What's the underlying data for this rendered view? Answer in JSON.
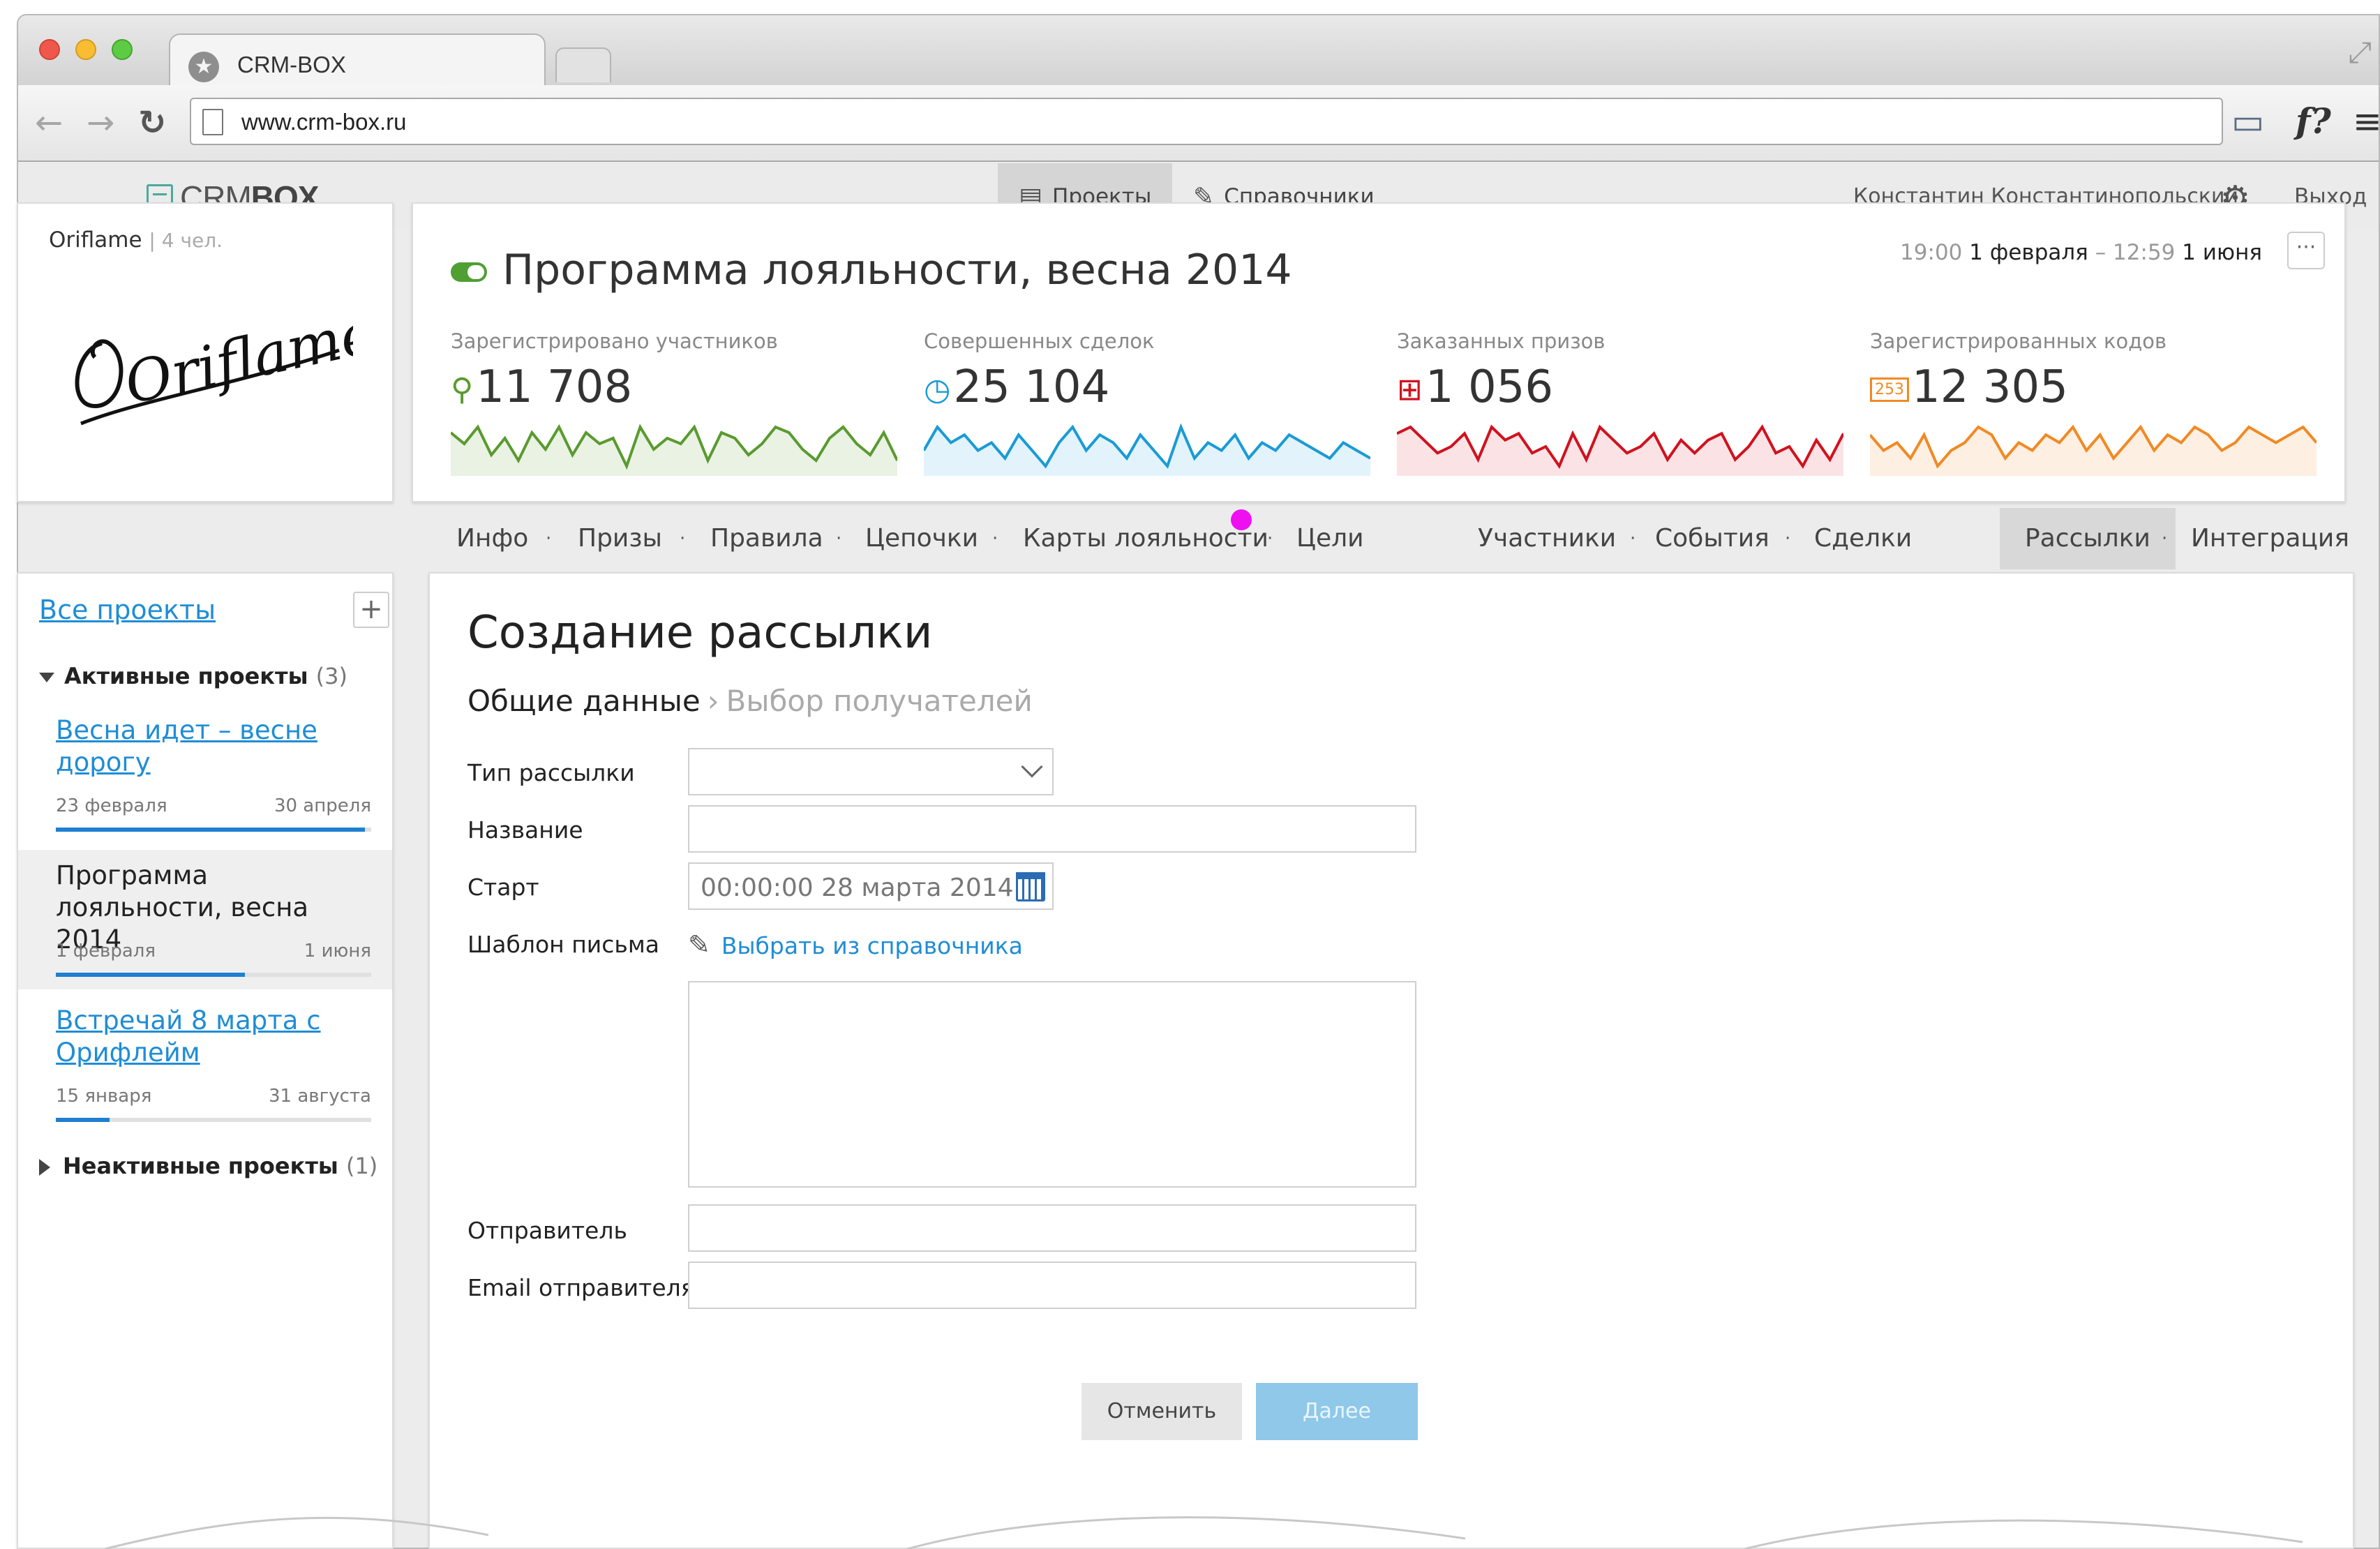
{
  "browser": {
    "tab_title": "CRM-BOX",
    "url": "www.crm-box.ru"
  },
  "app": {
    "logo_light": "CRM",
    "logo_bold": "BOX",
    "nav": {
      "projects": "Проекты",
      "references": "Справочники"
    },
    "user_name": "Константин Константинопольский",
    "logout": "Выход"
  },
  "project_card": {
    "name": "Oriflame",
    "members": "4 чел.",
    "logo_text": "Oriflame"
  },
  "campaign": {
    "title": "Программа лояльности, весна 2014",
    "start_time": "19:00",
    "start_date": "1 февраля",
    "dash": "–",
    "end_time": "12:59",
    "end_date": "1 июня",
    "more": "···",
    "stats": [
      {
        "label": "Зарегистрировано участников",
        "value": "11 708",
        "icon": "user-icon",
        "color": "#5a9a2f",
        "fill": "#e9f2e3",
        "spark": [
          8,
          6,
          9,
          4,
          7,
          3,
          8,
          5,
          9,
          4,
          8,
          6,
          7,
          2,
          9,
          5,
          7,
          6,
          9,
          3,
          8,
          7,
          4,
          6,
          9,
          8,
          5,
          3,
          7,
          9,
          6,
          4,
          8,
          3
        ]
      },
      {
        "label": "Совершенных сделок",
        "value": "25 104",
        "icon": "clock-icon",
        "color": "#1a9bd6",
        "fill": "#e2f3fb",
        "spark": [
          5,
          8,
          6,
          7,
          5,
          6,
          4,
          7,
          5,
          3,
          6,
          8,
          5,
          7,
          6,
          4,
          7,
          5,
          3,
          8,
          4,
          6,
          5,
          7,
          4,
          6,
          5,
          7,
          6,
          5,
          4,
          6,
          5,
          4
        ]
      },
      {
        "label": "Заказанных призов",
        "value": "1 056",
        "icon": "gift-icon",
        "color": "#d0121f",
        "fill": "#fbe3e5",
        "spark": [
          7,
          8,
          6,
          4,
          5,
          7,
          3,
          8,
          6,
          7,
          4,
          5,
          2,
          7,
          3,
          8,
          6,
          4,
          5,
          7,
          3,
          6,
          4,
          6,
          7,
          3,
          5,
          8,
          4,
          5,
          2,
          6,
          3,
          7
        ]
      },
      {
        "label": "Зарегистрированных кодов",
        "value": "12 305",
        "icon": "code-badge-icon",
        "color": "#f08a24",
        "fill": "#fdefe2",
        "spark": [
          5,
          3,
          4,
          2,
          5,
          1,
          3,
          4,
          6,
          5,
          2,
          4,
          3,
          5,
          4,
          6,
          3,
          5,
          2,
          4,
          6,
          3,
          5,
          4,
          6,
          5,
          3,
          4,
          6,
          5,
          4,
          5,
          6,
          4
        ]
      }
    ],
    "code_badge": "253"
  },
  "subnav": {
    "items": [
      "Инфо",
      "Призы",
      "Правила",
      "Цепочки",
      "Карты лояльности",
      "Цели",
      "Участники",
      "События",
      "Сделки",
      "Рассылки",
      "Интеграция"
    ],
    "dot": "·",
    "active": "Рассылки"
  },
  "sidebar": {
    "all_projects": "Все проекты",
    "add": "+",
    "active_group": "Активные  проекты",
    "active_count": "(3)",
    "inactive_group": "Неактивные проекты",
    "inactive_count": "(1)",
    "projects": [
      {
        "title": "Весна идет – весне дорогу",
        "start": "23 февраля",
        "end": "30 апреля",
        "progress": 0.98,
        "current": false
      },
      {
        "title": "Программа лояльности, весна 2014",
        "start": "1 февраля",
        "end": "1 июня",
        "progress": 0.6,
        "current": true
      },
      {
        "title": "Встречай 8 марта с Орифлейм",
        "start": "15 января",
        "end": "31 августа",
        "progress": 0.17,
        "current": false
      }
    ]
  },
  "form": {
    "title": "Создание рассылки",
    "step_current": "Общие данные",
    "step_sep": "›",
    "step_next": "Выбор получателей",
    "type_label": "Тип рассылки",
    "type_value": "",
    "name_label": "Название",
    "name_value": "",
    "start_label": "Старт",
    "start_value": "00:00:00  28 марта 2014",
    "template_label": "Шаблон письма",
    "template_link": "Выбрать из справочника",
    "template_body": "",
    "sender_label": "Отправитель",
    "sender_value": "",
    "sender_email_label": "Email отправителя",
    "sender_email_value": "",
    "cancel": "Отменить",
    "next": "Далее"
  }
}
